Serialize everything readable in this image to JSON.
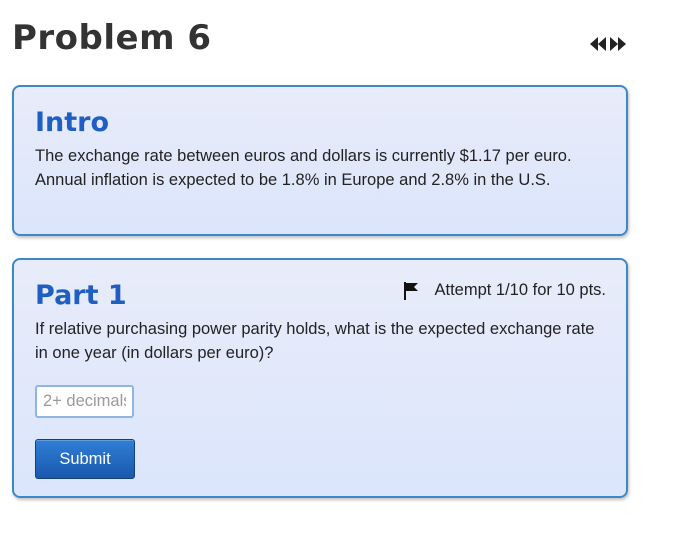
{
  "problem": {
    "title": "Problem 6",
    "nav_icon": "prev-next-arrows-icon"
  },
  "intro": {
    "heading": "Intro",
    "text": "The exchange rate between euros and dollars is currently $1.17 per euro. Annual inflation is expected to be 1.8% in Europe and 2.8% in the U.S."
  },
  "part1": {
    "heading": "Part 1",
    "flag_icon": "flag-icon",
    "attempt_text": "Attempt 1/10 for 10 pts.",
    "question": "If relative purchasing power parity holds, what is the expected exchange rate in one year (in dollars per euro)?",
    "answer": {
      "value": "",
      "placeholder": "2+ decimals"
    },
    "submit_label": "Submit"
  },
  "colors": {
    "heading_blue": "#1f5fc2",
    "card_border": "#3d88c8",
    "card_background": "#e3e9fa",
    "button_blue": "#1f66c1",
    "title_gray": "#333333"
  }
}
